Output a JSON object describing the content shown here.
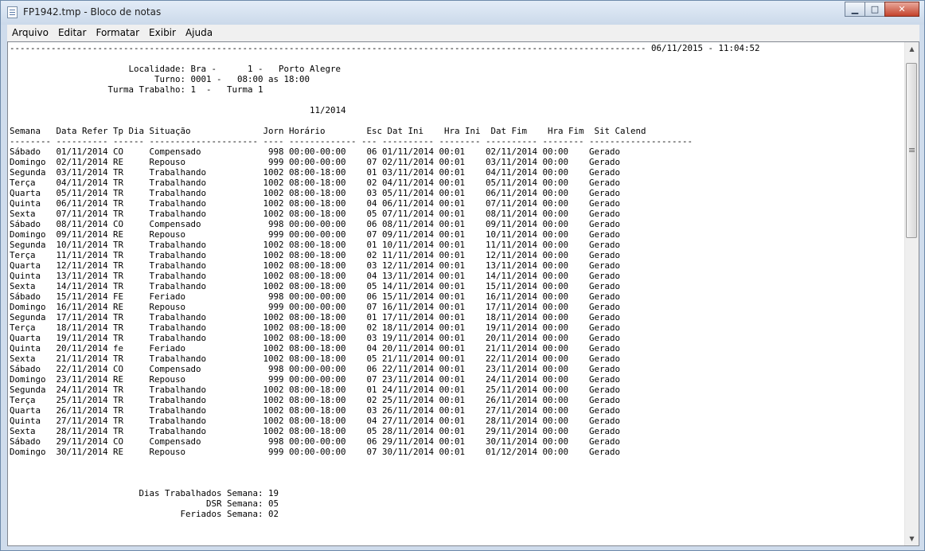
{
  "window": {
    "title": "FP1942.tmp - Bloco de notas",
    "minimize_glyph": "▁",
    "maximize_glyph": "□",
    "close_glyph": "✕"
  },
  "menu": [
    {
      "label": "Arquivo"
    },
    {
      "label": "Editar"
    },
    {
      "label": "Formatar"
    },
    {
      "label": "Exibir"
    },
    {
      "label": "Ajuda"
    }
  ],
  "document": {
    "lines": [
      "--------------------------------------------------------------------------------------------------------------------------- 06/11/2015 - 11:04:52",
      "",
      "                       Localidade: Bra -      1 -   Porto Alegre",
      "                            Turno: 0001 -   08:00 as 18:00",
      "                   Turma Trabalho: 1  -   Turma 1",
      "",
      "                                                          11/2014",
      "",
      "Semana   Data Refer Tp Dia Situação              Jorn Horário        Esc Dat Ini    Hra Ini  Dat Fim    Hra Fim  Sit Calend",
      "-------- ---------- ------ --------------------- ---- ------------- --- ---------- -------- ---------- -------- --------------------",
      "Sábado   01/11/2014 CO     Compensado             998 00:00-00:00    06 01/11/2014 00:01    02/11/2014 00:00    Gerado",
      "Domingo  02/11/2014 RE     Repouso                999 00:00-00:00    07 02/11/2014 00:01    03/11/2014 00:00    Gerado",
      "Segunda  03/11/2014 TR     Trabalhando           1002 08:00-18:00    01 03/11/2014 00:01    04/11/2014 00:00    Gerado",
      "Terça    04/11/2014 TR     Trabalhando           1002 08:00-18:00    02 04/11/2014 00:01    05/11/2014 00:00    Gerado",
      "Quarta   05/11/2014 TR     Trabalhando           1002 08:00-18:00    03 05/11/2014 00:01    06/11/2014 00:00    Gerado",
      "Quinta   06/11/2014 TR     Trabalhando           1002 08:00-18:00    04 06/11/2014 00:01    07/11/2014 00:00    Gerado",
      "Sexta    07/11/2014 TR     Trabalhando           1002 08:00-18:00    05 07/11/2014 00:01    08/11/2014 00:00    Gerado",
      "Sábado   08/11/2014 CO     Compensado             998 00:00-00:00    06 08/11/2014 00:01    09/11/2014 00:00    Gerado",
      "Domingo  09/11/2014 RE     Repouso                999 00:00-00:00    07 09/11/2014 00:01    10/11/2014 00:00    Gerado",
      "Segunda  10/11/2014 TR     Trabalhando           1002 08:00-18:00    01 10/11/2014 00:01    11/11/2014 00:00    Gerado",
      "Terça    11/11/2014 TR     Trabalhando           1002 08:00-18:00    02 11/11/2014 00:01    12/11/2014 00:00    Gerado",
      "Quarta   12/11/2014 TR     Trabalhando           1002 08:00-18:00    03 12/11/2014 00:01    13/11/2014 00:00    Gerado",
      "Quinta   13/11/2014 TR     Trabalhando           1002 08:00-18:00    04 13/11/2014 00:01    14/11/2014 00:00    Gerado",
      "Sexta    14/11/2014 TR     Trabalhando           1002 08:00-18:00    05 14/11/2014 00:01    15/11/2014 00:00    Gerado",
      "Sábado   15/11/2014 FE     Feriado                998 00:00-00:00    06 15/11/2014 00:01    16/11/2014 00:00    Gerado",
      "Domingo  16/11/2014 RE     Repouso                999 00:00-00:00    07 16/11/2014 00:01    17/11/2014 00:00    Gerado",
      "Segunda  17/11/2014 TR     Trabalhando           1002 08:00-18:00    01 17/11/2014 00:01    18/11/2014 00:00    Gerado",
      "Terça    18/11/2014 TR     Trabalhando           1002 08:00-18:00    02 18/11/2014 00:01    19/11/2014 00:00    Gerado",
      "Quarta   19/11/2014 TR     Trabalhando           1002 08:00-18:00    03 19/11/2014 00:01    20/11/2014 00:00    Gerado",
      "Quinta   20/11/2014 fe     Feriado               1002 08:00-18:00    04 20/11/2014 00:01    21/11/2014 00:00    Gerado",
      "Sexta    21/11/2014 TR     Trabalhando           1002 08:00-18:00    05 21/11/2014 00:01    22/11/2014 00:00    Gerado",
      "Sábado   22/11/2014 CO     Compensado             998 00:00-00:00    06 22/11/2014 00:01    23/11/2014 00:00    Gerado",
      "Domingo  23/11/2014 RE     Repouso                999 00:00-00:00    07 23/11/2014 00:01    24/11/2014 00:00    Gerado",
      "Segunda  24/11/2014 TR     Trabalhando           1002 08:00-18:00    01 24/11/2014 00:01    25/11/2014 00:00    Gerado",
      "Terça    25/11/2014 TR     Trabalhando           1002 08:00-18:00    02 25/11/2014 00:01    26/11/2014 00:00    Gerado",
      "Quarta   26/11/2014 TR     Trabalhando           1002 08:00-18:00    03 26/11/2014 00:01    27/11/2014 00:00    Gerado",
      "Quinta   27/11/2014 TR     Trabalhando           1002 08:00-18:00    04 27/11/2014 00:01    28/11/2014 00:00    Gerado",
      "Sexta    28/11/2014 TR     Trabalhando           1002 08:00-18:00    05 28/11/2014 00:01    29/11/2014 00:00    Gerado",
      "Sábado   29/11/2014 CO     Compensado             998 00:00-00:00    06 29/11/2014 00:01    30/11/2014 00:00    Gerado",
      "Domingo  30/11/2014 RE     Repouso                999 00:00-00:00    07 30/11/2014 00:01    01/12/2014 00:00    Gerado",
      "",
      "",
      "",
      "                         Dias Trabalhados Semana: 19",
      "                                      DSR Semana: 05",
      "                                 Feriados Semana: 02"
    ]
  },
  "scrollbar": {
    "up_glyph": "▲",
    "down_glyph": "▼"
  }
}
